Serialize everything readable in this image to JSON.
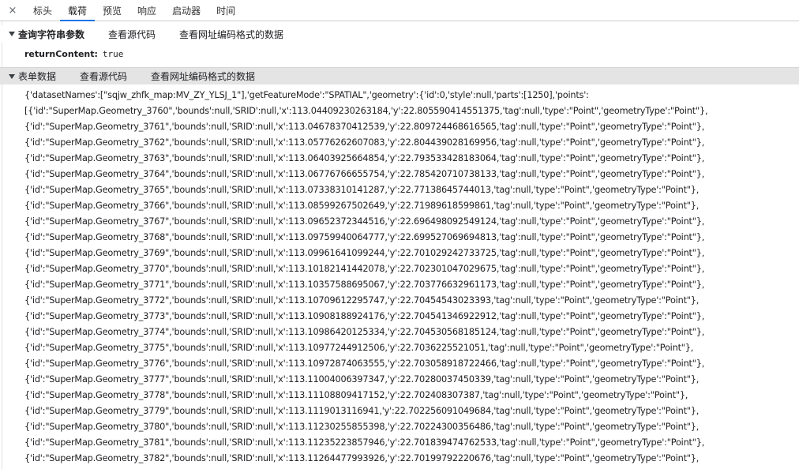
{
  "tabs": {
    "close": "×",
    "items": [
      {
        "label": "标头"
      },
      {
        "label": "载荷"
      },
      {
        "label": "预览"
      },
      {
        "label": "响应"
      },
      {
        "label": "启动器"
      },
      {
        "label": "时间"
      }
    ]
  },
  "query_section": {
    "title": "查询字符串参数",
    "view_source": "查看源代码",
    "view_url_encoded": "查看网址编码格式的数据",
    "params": [
      {
        "name": "returnContent:",
        "value": "true"
      }
    ]
  },
  "form_section": {
    "title": "表单数据",
    "view_source": "查看源代码",
    "view_url_encoded": "查看网址编码格式的数据",
    "lines": [
      "{'datasetNames':[\"sqjw_zhfk_map:MV_ZY_YLSJ_1\"],'getFeatureMode':\"SPATIAL\",'geometry':{'id':0,'style':null,'parts':[1250],'points':",
      "[{'id':\"SuperMap.Geometry_3760\",'bounds':null,'SRID':null,'x':113.04409230263184,'y':22.805590414551375,'tag':null,'type':\"Point\",'geometryType':\"Point\"},",
      "{'id':\"SuperMap.Geometry_3761\",'bounds':null,'SRID':null,'x':113.04678370412539,'y':22.809724468616565,'tag':null,'type':\"Point\",'geometryType':\"Point\"},",
      "{'id':\"SuperMap.Geometry_3762\",'bounds':null,'SRID':null,'x':113.05776262607083,'y':22.804439028169956,'tag':null,'type':\"Point\",'geometryType':\"Point\"},",
      "{'id':\"SuperMap.Geometry_3763\",'bounds':null,'SRID':null,'x':113.06403925664854,'y':22.793533428183064,'tag':null,'type':\"Point\",'geometryType':\"Point\"},",
      "{'id':\"SuperMap.Geometry_3764\",'bounds':null,'SRID':null,'x':113.06776766655754,'y':22.785420710738133,'tag':null,'type':\"Point\",'geometryType':\"Point\"},",
      "{'id':\"SuperMap.Geometry_3765\",'bounds':null,'SRID':null,'x':113.07338310141287,'y':22.77138645744013,'tag':null,'type':\"Point\",'geometryType':\"Point\"},",
      "{'id':\"SuperMap.Geometry_3766\",'bounds':null,'SRID':null,'x':113.08599267502649,'y':22.71989618599861,'tag':null,'type':\"Point\",'geometryType':\"Point\"},",
      "{'id':\"SuperMap.Geometry_3767\",'bounds':null,'SRID':null,'x':113.09652372344516,'y':22.696498092549124,'tag':null,'type':\"Point\",'geometryType':\"Point\"},",
      "{'id':\"SuperMap.Geometry_3768\",'bounds':null,'SRID':null,'x':113.09759940064777,'y':22.699527069694813,'tag':null,'type':\"Point\",'geometryType':\"Point\"},",
      "{'id':\"SuperMap.Geometry_3769\",'bounds':null,'SRID':null,'x':113.09961641099244,'y':22.701029242733725,'tag':null,'type':\"Point\",'geometryType':\"Point\"},",
      "{'id':\"SuperMap.Geometry_3770\",'bounds':null,'SRID':null,'x':113.10182141442078,'y':22.702301047029675,'tag':null,'type':\"Point\",'geometryType':\"Point\"},",
      "{'id':\"SuperMap.Geometry_3771\",'bounds':null,'SRID':null,'x':113.10357588695067,'y':22.703776632961173,'tag':null,'type':\"Point\",'geometryType':\"Point\"},",
      "{'id':\"SuperMap.Geometry_3772\",'bounds':null,'SRID':null,'x':113.10709612295747,'y':22.70454543023393,'tag':null,'type':\"Point\",'geometryType':\"Point\"},",
      "{'id':\"SuperMap.Geometry_3773\",'bounds':null,'SRID':null,'x':113.10908188924176,'y':22.704541346922912,'tag':null,'type':\"Point\",'geometryType':\"Point\"},",
      "{'id':\"SuperMap.Geometry_3774\",'bounds':null,'SRID':null,'x':113.10986420125334,'y':22.704530568185124,'tag':null,'type':\"Point\",'geometryType':\"Point\"},",
      "{'id':\"SuperMap.Geometry_3775\",'bounds':null,'SRID':null,'x':113.10977244912506,'y':22.7036225521051,'tag':null,'type':\"Point\",'geometryType':\"Point\"},",
      "{'id':\"SuperMap.Geometry_3776\",'bounds':null,'SRID':null,'x':113.10972874063555,'y':22.703058918722466,'tag':null,'type':\"Point\",'geometryType':\"Point\"},",
      "{'id':\"SuperMap.Geometry_3777\",'bounds':null,'SRID':null,'x':113.11004006397347,'y':22.70280037450339,'tag':null,'type':\"Point\",'geometryType':\"Point\"},",
      "{'id':\"SuperMap.Geometry_3778\",'bounds':null,'SRID':null,'x':113.11108809417152,'y':22.702408307387,'tag':null,'type':\"Point\",'geometryType':\"Point\"},",
      "{'id':\"SuperMap.Geometry_3779\",'bounds':null,'SRID':null,'x':113.1119013116941,'y':22.702256091049684,'tag':null,'type':\"Point\",'geometryType':\"Point\"},",
      "{'id':\"SuperMap.Geometry_3780\",'bounds':null,'SRID':null,'x':113.11230255855398,'y':22.70224300356486,'tag':null,'type':\"Point\",'geometryType':\"Point\"},",
      "{'id':\"SuperMap.Geometry_3781\",'bounds':null,'SRID':null,'x':113.11235223857946,'y':22.701839474762533,'tag':null,'type':\"Point\",'geometryType':\"Point\"},",
      "{'id':\"SuperMap.Geometry_3782\",'bounds':null,'SRID':null,'x':113.11264477993926,'y':22.70199792220676,'tag':null,'type':\"Point\",'geometryType':\"Point\"},"
    ]
  },
  "colors": {
    "active_tab_underline": "#1a73e8",
    "form_header_bg": "#e4e4e4"
  }
}
